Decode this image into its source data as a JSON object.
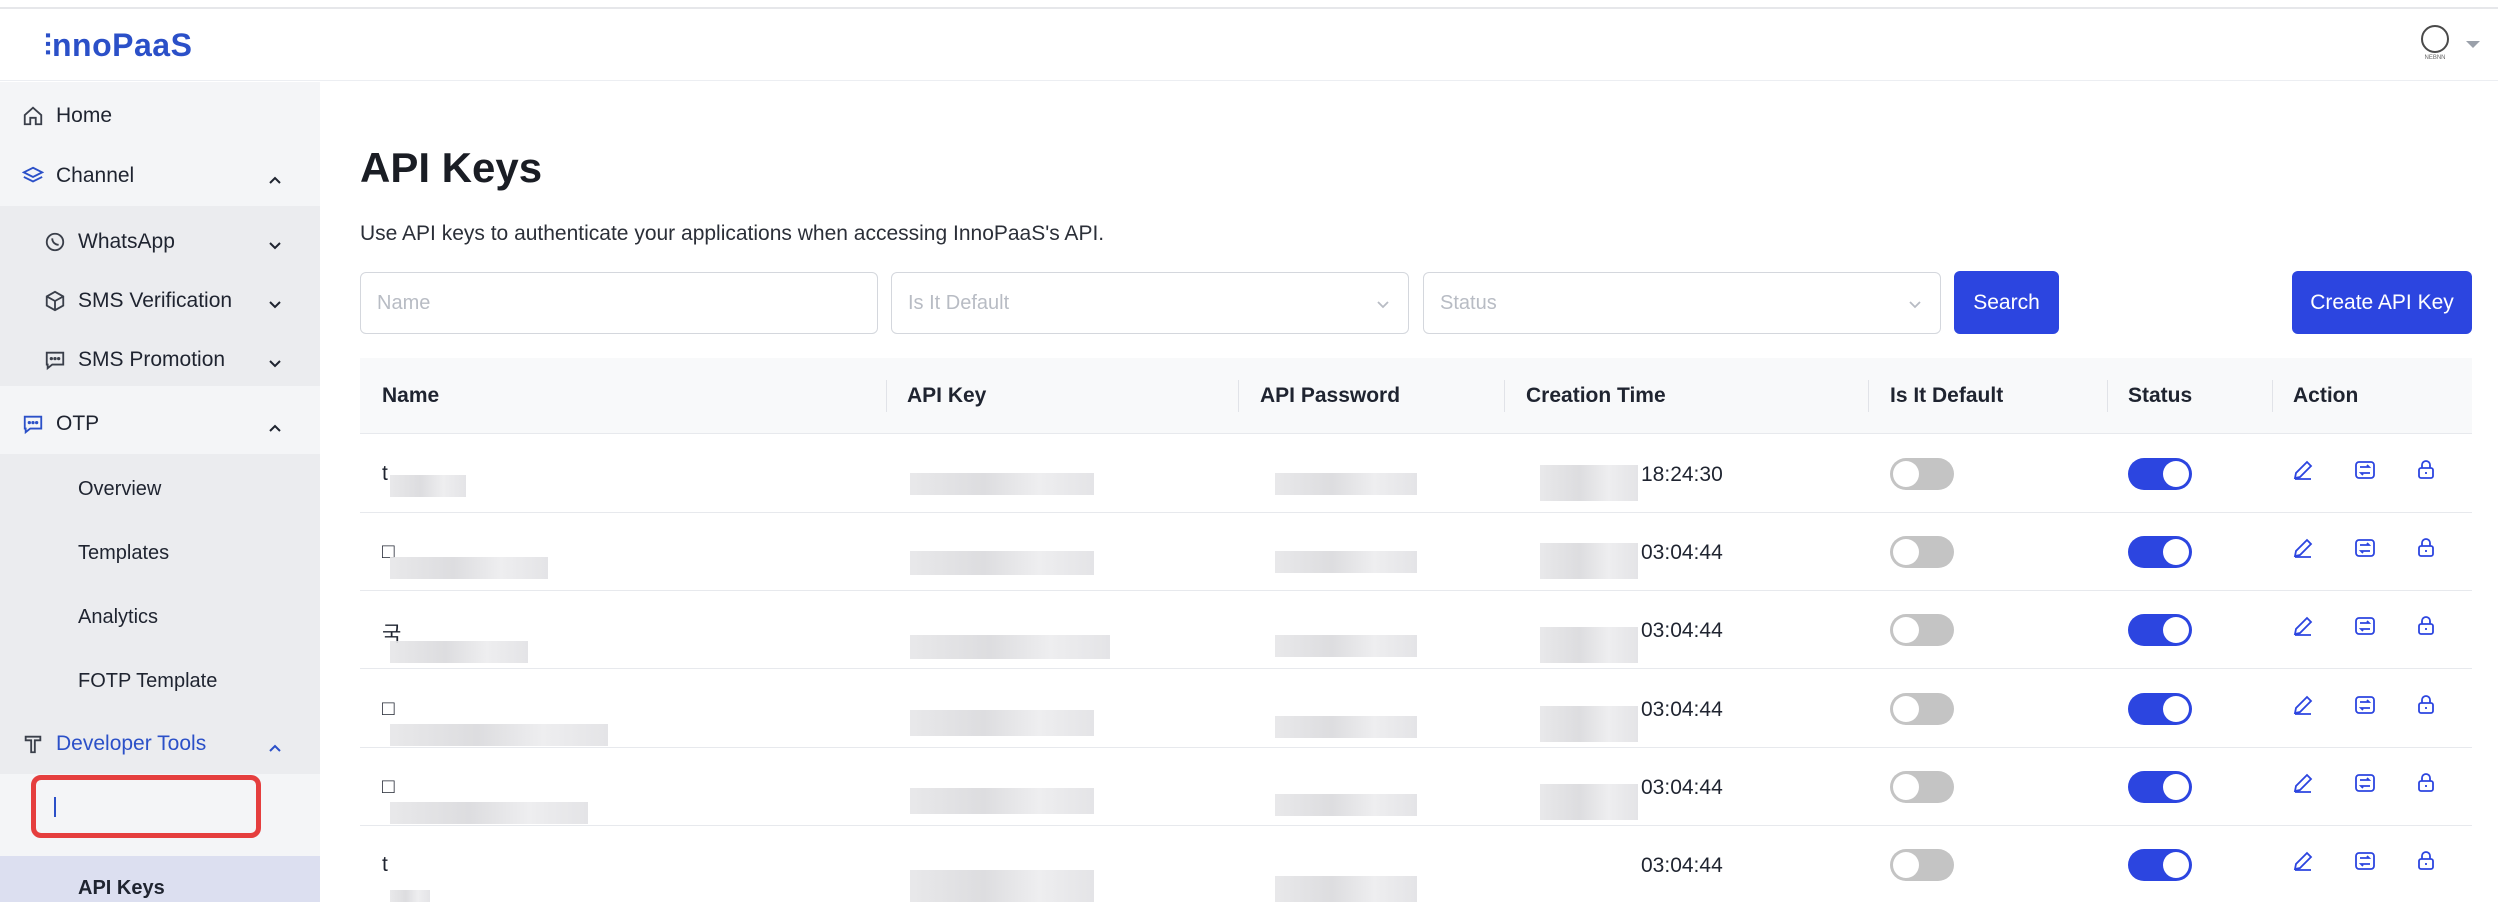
{
  "app": {
    "logo_text": "nnoPaaS",
    "logo_mark": "⫶",
    "avatar_caption": "NEBNN"
  },
  "sidebar": {
    "home": "Home",
    "channel": "Channel",
    "whatsapp": "WhatsApp",
    "sms_verification": "SMS Verification",
    "sms_promotion": "SMS Promotion",
    "otp": "OTP",
    "overview": "Overview",
    "templates": "Templates",
    "analytics": "Analytics",
    "fotp_template": "FOTP Template",
    "developer_tools": "Developer Tools",
    "api_keys": "API Keys"
  },
  "page": {
    "title": "API Keys",
    "description": "Use API keys to authenticate your applications when accessing InnoPaaS's API."
  },
  "filters": {
    "name_placeholder": "Name",
    "default_placeholder": "Is It Default",
    "status_placeholder": "Status",
    "search_label": "Search",
    "create_label": "Create API Key"
  },
  "table": {
    "columns": [
      "Name",
      "API Key",
      "API Password",
      "Creation Time",
      "Is It Default",
      "Status",
      "Action"
    ],
    "rows": [
      {
        "name_prefix": "t",
        "time": "18:24:30",
        "is_default": false,
        "status": true
      },
      {
        "name_prefix": "□",
        "time": "03:04:44",
        "is_default": false,
        "status": true
      },
      {
        "name_prefix": "국",
        "time": "03:04:44",
        "is_default": false,
        "status": true
      },
      {
        "name_prefix": "□",
        "time": "03:04:44",
        "is_default": false,
        "status": true
      },
      {
        "name_prefix": "□",
        "time": "03:04:44",
        "is_default": false,
        "status": true
      },
      {
        "name_prefix": "t",
        "time": "03:04:44",
        "is_default": false,
        "status": true
      }
    ]
  },
  "colors": {
    "accent": "#2c45e0",
    "brand": "#2b50c8",
    "highlight_box": "#e53e3e"
  }
}
